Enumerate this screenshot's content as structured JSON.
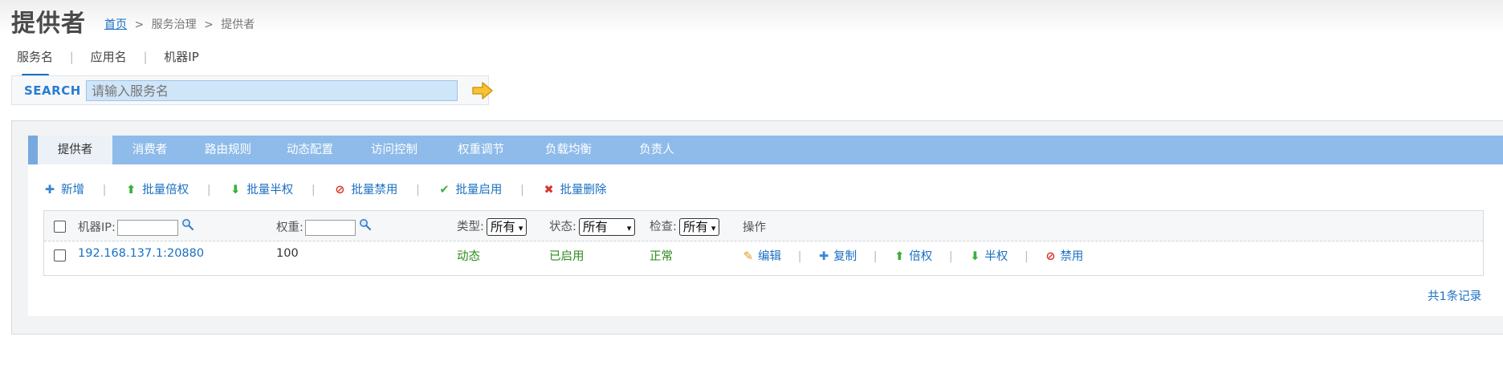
{
  "page": {
    "title": "提供者",
    "breadcrumb": {
      "home": "首页",
      "sep1": ">",
      "section": "服务治理",
      "sep2": ">",
      "current": "提供者"
    }
  },
  "search": {
    "tabs": [
      "服务名",
      "应用名",
      "机器IP"
    ],
    "separator": "|",
    "label": "SEARCH",
    "placeholder": "请输入服务名",
    "value": ""
  },
  "main_tabs": [
    "提供者",
    "消费者",
    "路由规则",
    "动态配置",
    "访问控制",
    "权重调节",
    "负载均衡",
    "负责人"
  ],
  "toolbar": {
    "separator": "|",
    "actions": [
      {
        "label": "新增",
        "icon": "plus-icon",
        "glyph": "✚",
        "color": "#3a86d6"
      },
      {
        "label": "批量倍权",
        "icon": "arrow-up-icon",
        "glyph": "⬆",
        "color": "#3bb03b"
      },
      {
        "label": "批量半权",
        "icon": "arrow-down-icon",
        "glyph": "⬇",
        "color": "#3bb03b"
      },
      {
        "label": "批量禁用",
        "icon": "forbidden-icon",
        "glyph": "⊘",
        "color": "#d9342b"
      },
      {
        "label": "批量启用",
        "icon": "check-icon",
        "glyph": "✔",
        "color": "#3bb03b"
      },
      {
        "label": "批量删除",
        "icon": "cross-icon",
        "glyph": "✖",
        "color": "#d9342b"
      }
    ]
  },
  "grid": {
    "headers": {
      "ip": "机器IP:",
      "weight": "权重:",
      "type": "类型:",
      "type_value": "所有",
      "status": "状态:",
      "status_value": "所有",
      "check": "检查:",
      "check_value": "所有",
      "ops": "操作"
    },
    "rows": [
      {
        "ip": "192.168.137.1:20880",
        "weight": "100",
        "type": "动态",
        "status": "已启用",
        "check": "正常",
        "actions": [
          {
            "label": "编辑",
            "icon": "pencil-icon",
            "glyph": "✎",
            "color": "#e0961b"
          },
          {
            "label": "复制",
            "icon": "plus-icon",
            "glyph": "✚",
            "color": "#3a86d6"
          },
          {
            "label": "倍权",
            "icon": "arrow-up-icon",
            "glyph": "⬆",
            "color": "#3bb03b"
          },
          {
            "label": "半权",
            "icon": "arrow-down-icon",
            "glyph": "⬇",
            "color": "#3bb03b"
          },
          {
            "label": "禁用",
            "icon": "forbidden-icon",
            "glyph": "⊘",
            "color": "#d9342b"
          }
        ]
      }
    ],
    "op_separator": "|"
  },
  "footer": {
    "total": "共1条记录"
  },
  "colors": {
    "accent": "#1a70c2",
    "tabbar": "#8ebbea",
    "green_status": "#2e8b1e"
  }
}
